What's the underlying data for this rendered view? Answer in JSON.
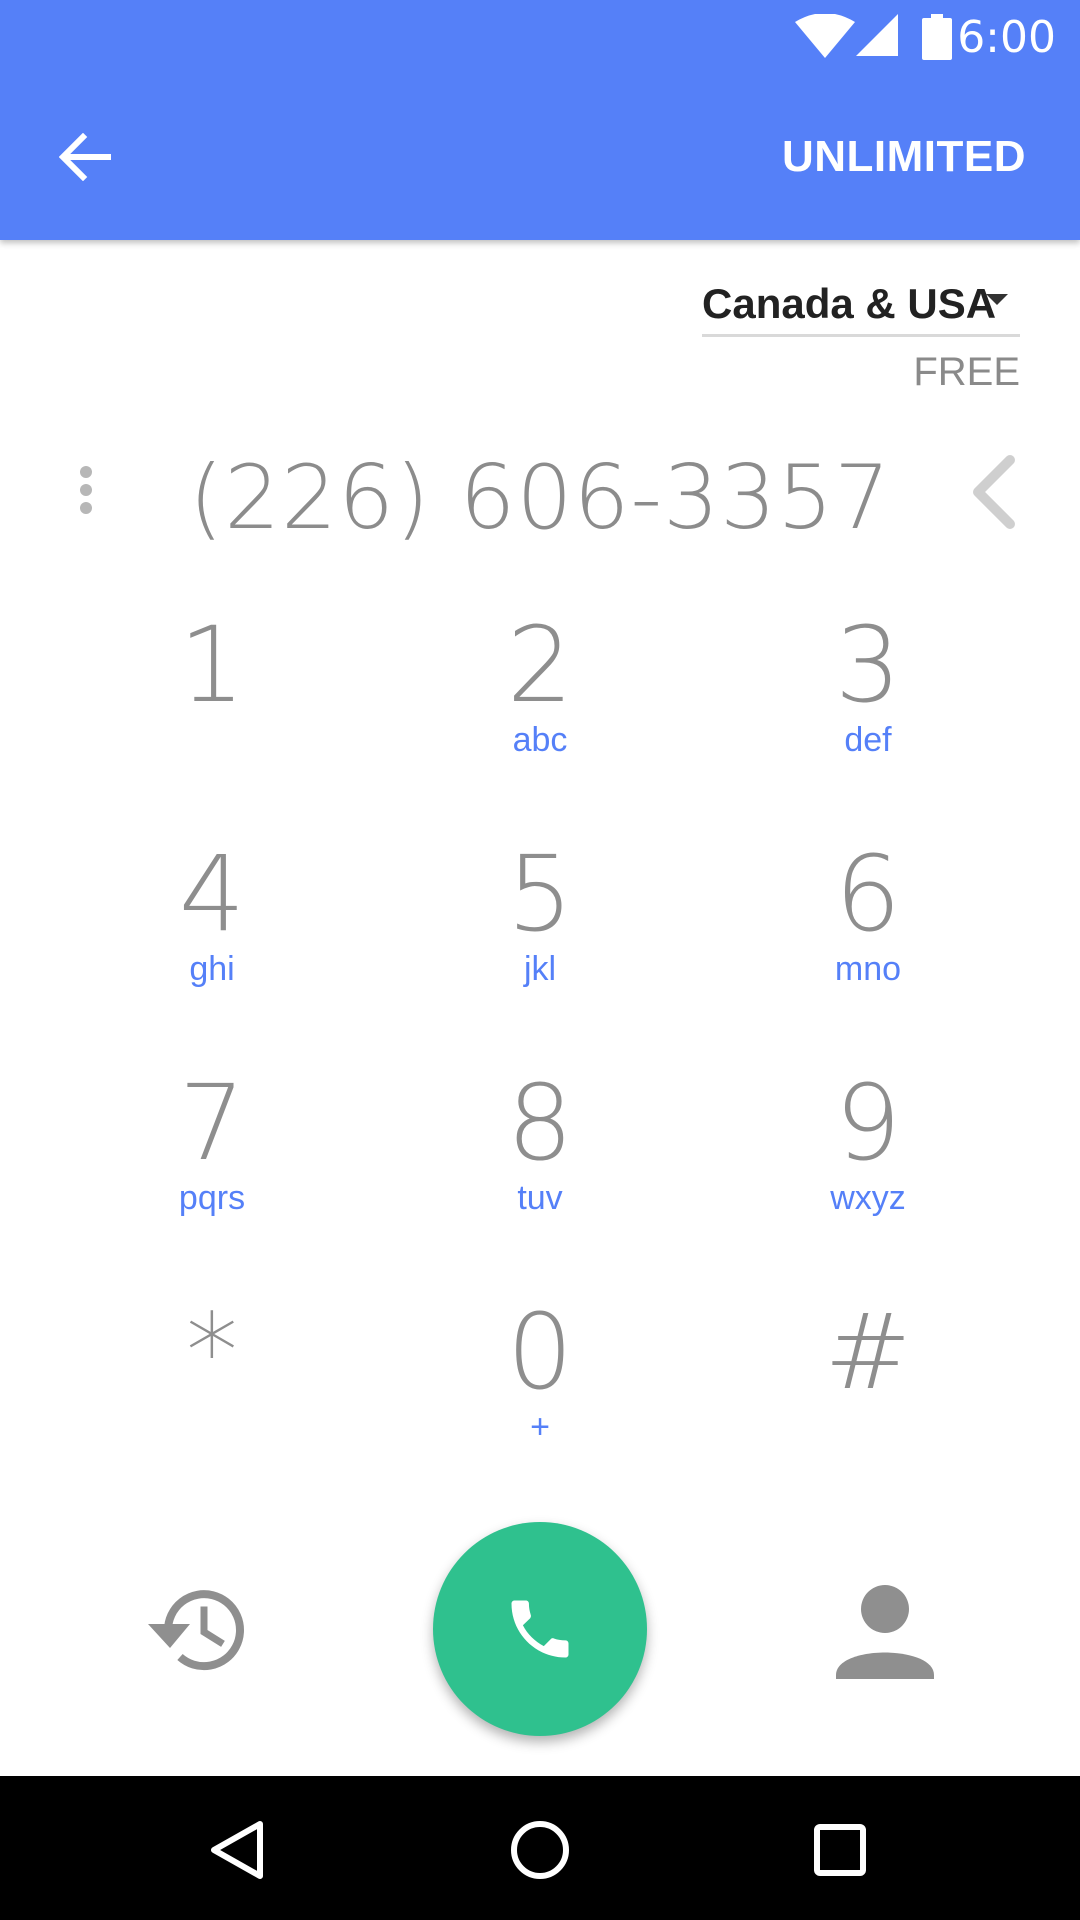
{
  "status_bar": {
    "time": "6:00",
    "icons": [
      "wifi-icon",
      "cellular-signal-icon",
      "battery-icon"
    ]
  },
  "app_bar": {
    "back_icon": "arrow-left-icon",
    "plan_label": "UNLIMITED",
    "color": "#5580F8"
  },
  "region": {
    "selected": "Canada & USA",
    "rate": "FREE"
  },
  "dial_display": {
    "number": "(226) 606-3357"
  },
  "keypad": [
    {
      "digit": "1",
      "letters": ""
    },
    {
      "digit": "2",
      "letters": "abc"
    },
    {
      "digit": "3",
      "letters": "def"
    },
    {
      "digit": "4",
      "letters": "ghi"
    },
    {
      "digit": "5",
      "letters": "jkl"
    },
    {
      "digit": "6",
      "letters": "mno"
    },
    {
      "digit": "7",
      "letters": "pqrs"
    },
    {
      "digit": "8",
      "letters": "tuv"
    },
    {
      "digit": "9",
      "letters": "wxyz"
    },
    {
      "digit": "*",
      "letters": ""
    },
    {
      "digit": "0",
      "letters": "+"
    },
    {
      "digit": "#",
      "letters": ""
    }
  ],
  "actions": {
    "history_icon": "history-icon",
    "call_icon": "phone-icon",
    "call_color": "#2FC18E",
    "contacts_icon": "person-icon"
  },
  "nav_bar": {
    "buttons": [
      "back-triangle-icon",
      "home-circle-icon",
      "recents-square-icon"
    ]
  }
}
